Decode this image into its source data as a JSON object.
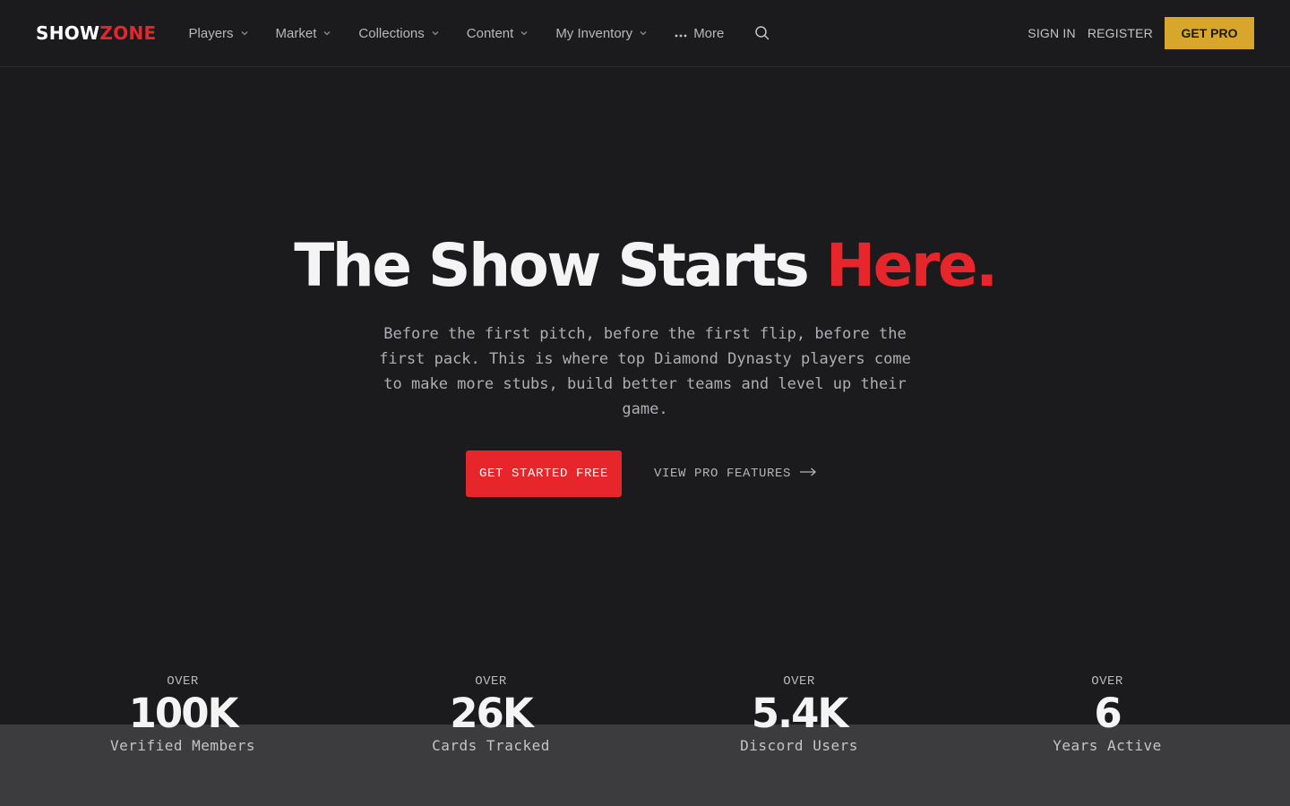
{
  "brand": {
    "logo_part1": "SHOW",
    "logo_part2": "ZONE"
  },
  "nav": {
    "items": [
      {
        "label": "Players",
        "icon": "chevron-down-icon"
      },
      {
        "label": "Market",
        "icon": "chevron-down-icon"
      },
      {
        "label": "Collections",
        "icon": "chevron-down-icon"
      },
      {
        "label": "Content",
        "icon": "chevron-down-icon"
      },
      {
        "label": "My Inventory",
        "icon": "chevron-down-icon"
      }
    ],
    "more_label": "More",
    "search_icon": "search-icon",
    "sign_in": "SIGN IN",
    "register": "REGISTER",
    "get_pro": "GET PRO"
  },
  "hero": {
    "title_main": "The Show Starts ",
    "title_accent": "Here.",
    "subtitle": "Before the first pitch, before the first flip, before the first pack. This is where top Diamond Dynasty players come to make more stubs, build better teams and level up their game.",
    "cta_primary": "GET STARTED FREE",
    "cta_secondary": "VIEW PRO FEATURES"
  },
  "stats": [
    {
      "prefix": "OVER",
      "value": "100K",
      "label": "Verified Members"
    },
    {
      "prefix": "OVER",
      "value": "26K",
      "label": "Cards Tracked"
    },
    {
      "prefix": "OVER",
      "value": "5.4K",
      "label": "Discord Users"
    },
    {
      "prefix": "OVER",
      "value": "6",
      "label": "Years Active"
    }
  ],
  "colors": {
    "background": "#1b1b1e",
    "accent_red": "#e6262b",
    "pro_gold": "#d7a62a",
    "stats_band": "#3c3c3f"
  }
}
